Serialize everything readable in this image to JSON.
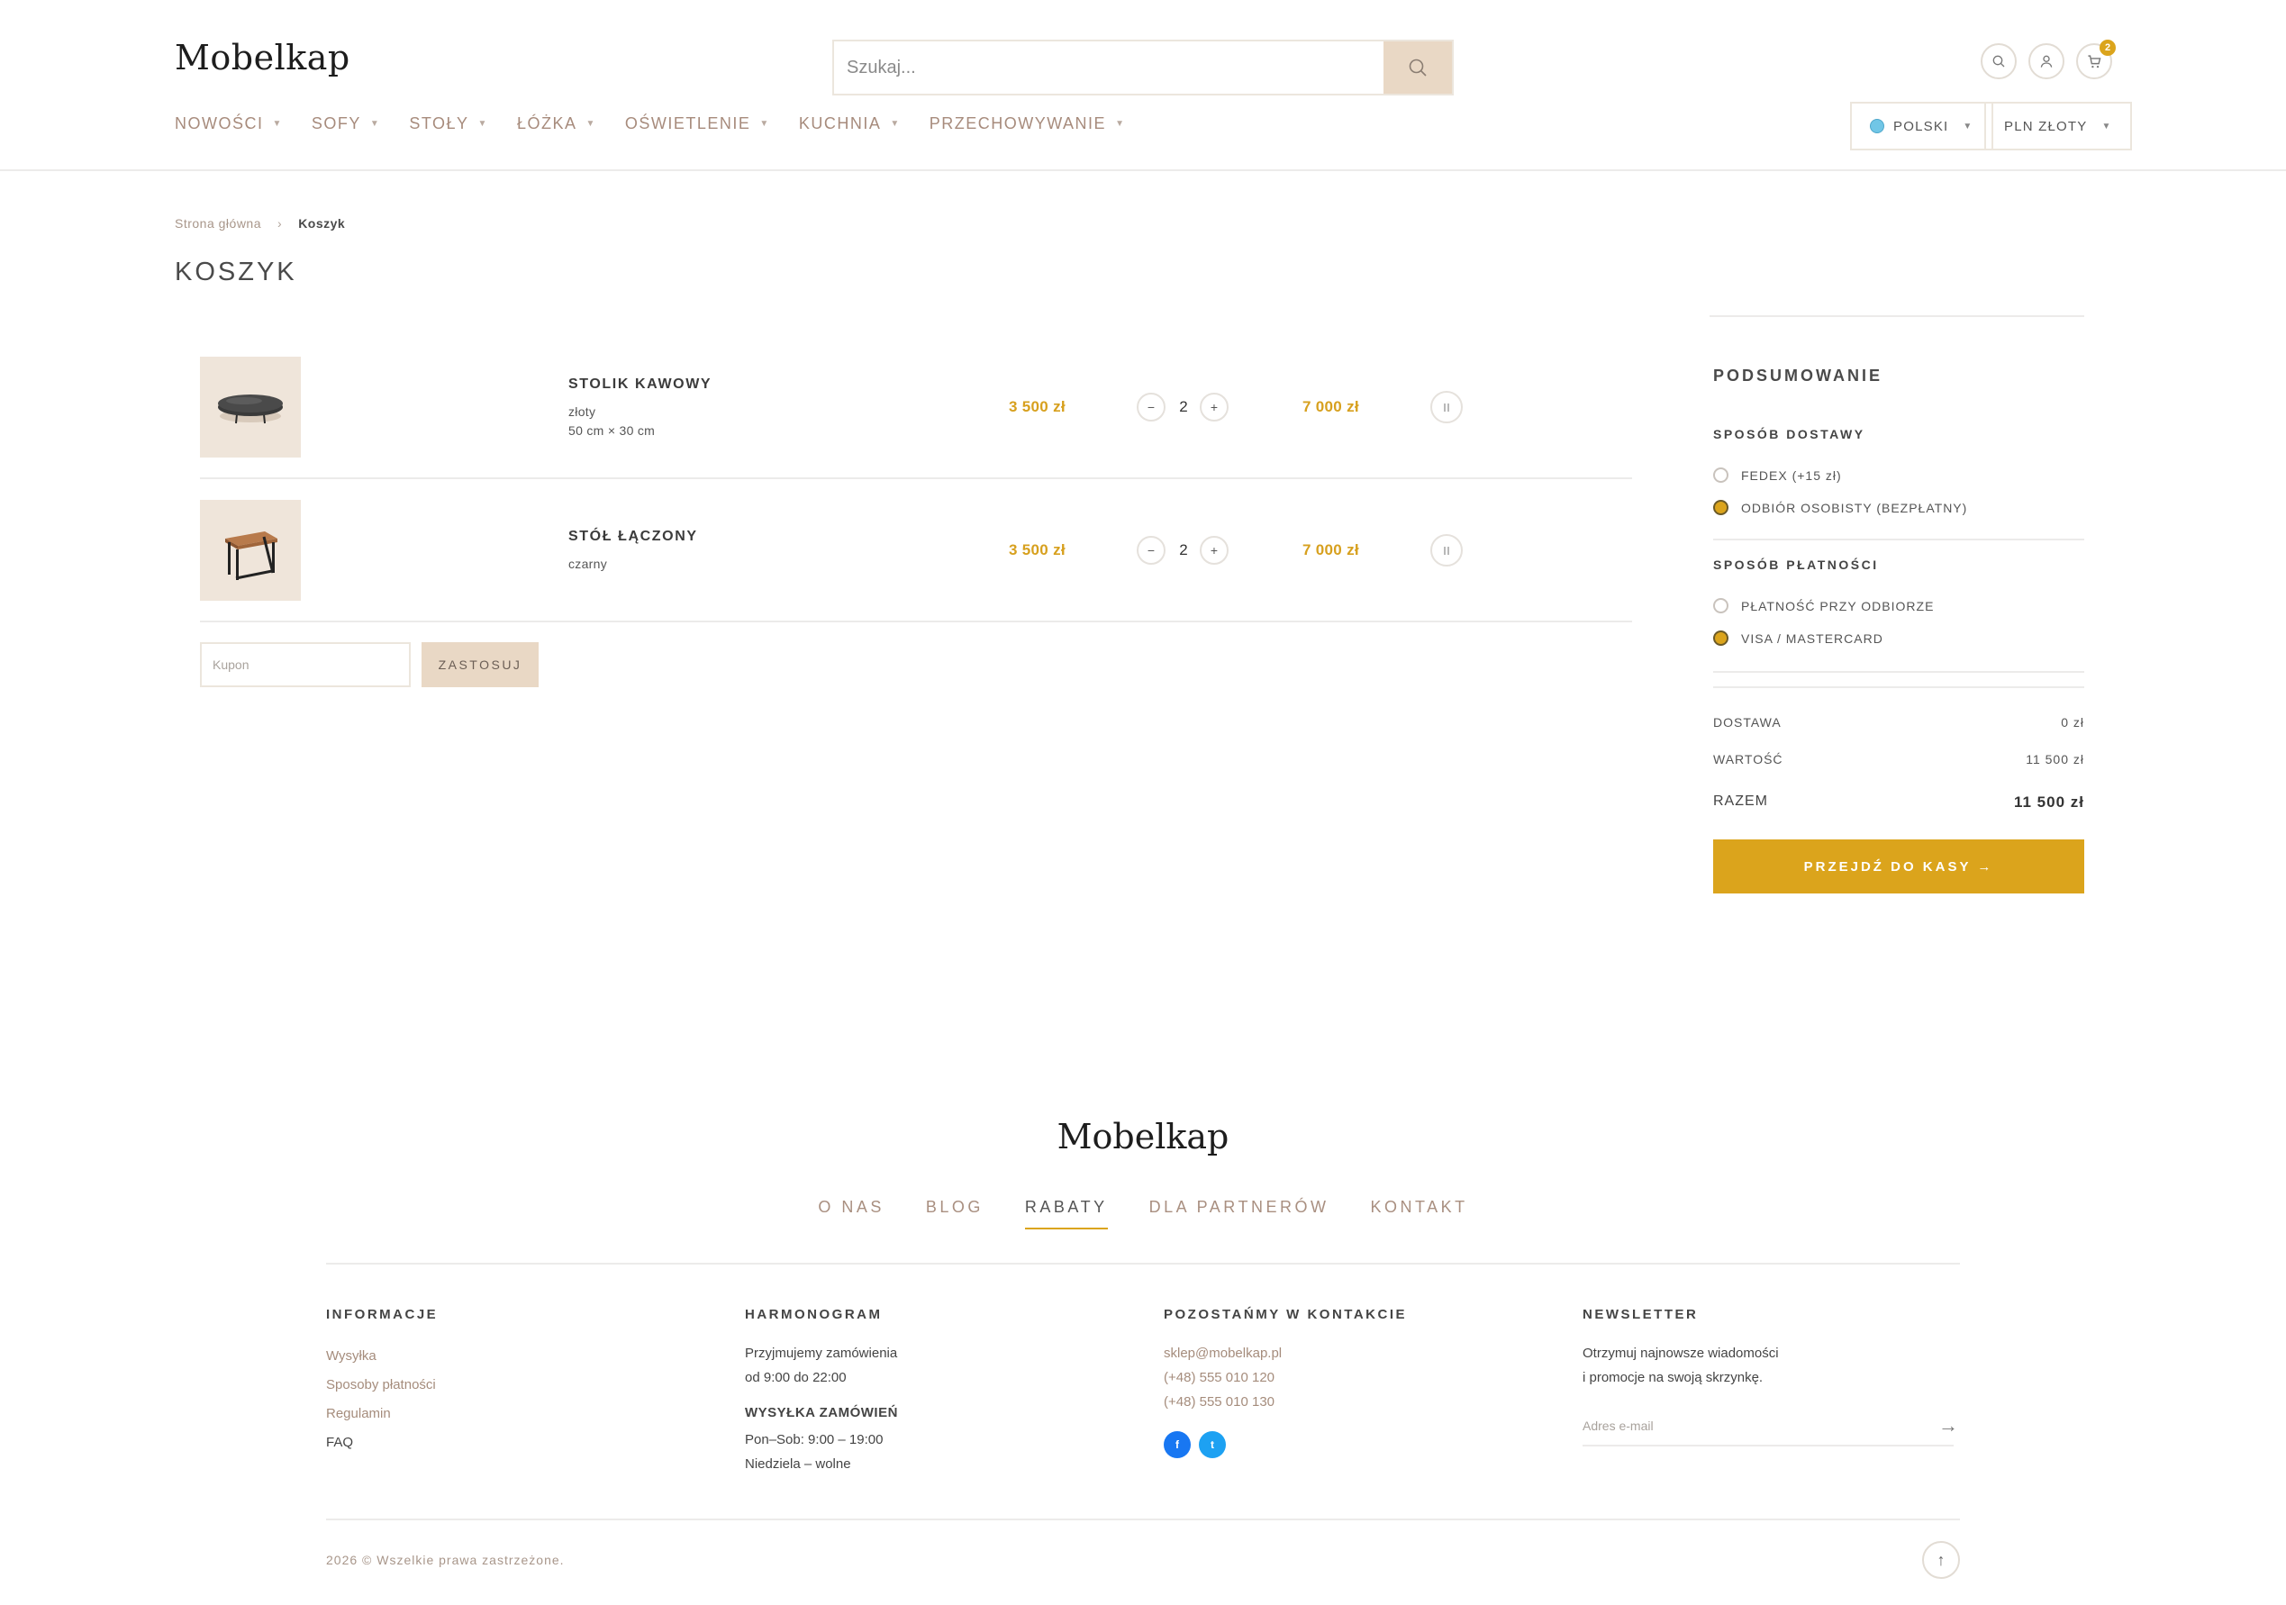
{
  "header": {
    "logo": "Mobelkap",
    "search_placeholder": "Szukaj...",
    "cart_count": "2",
    "language": "POLSKI",
    "currency": "PLN ZŁOTY"
  },
  "nav": [
    {
      "label": "NOWOŚCI"
    },
    {
      "label": "SOFY"
    },
    {
      "label": "STOŁY"
    },
    {
      "label": "ŁÓŻKA"
    },
    {
      "label": "OŚWIETLENIE"
    },
    {
      "label": "KUCHNIA"
    },
    {
      "label": "PRZECHOWYWANIE"
    }
  ],
  "breadcrumb": {
    "home": "Strona główna",
    "sep": "›",
    "current": "Koszyk"
  },
  "page_title": "KOSZYK",
  "cart": {
    "items": [
      {
        "name": "STOLIK KAWOWY",
        "attr1": "złoty",
        "attr2": "50 cm × 30 cm",
        "price": "3 500 zł",
        "qty": "2",
        "total": "7 000 zł"
      },
      {
        "name": "STÓŁ ŁĄCZONY",
        "attr1": "czarny",
        "attr2": "",
        "price": "3 500 zł",
        "qty": "2",
        "total": "7 000 zł"
      }
    ],
    "minus": "−",
    "plus": "+",
    "coupon_placeholder": "Kupon",
    "coupon_button": "ZASTOSUJ"
  },
  "summary": {
    "title": "PODSUMOWANIE",
    "delivery_title": "SPOSÓB DOSTAWY",
    "delivery_options": [
      {
        "label": "FEDEX (+15 zł)",
        "selected": false
      },
      {
        "label": "ODBIÓR OSOBISTY (BEZPŁATNY)",
        "selected": true
      }
    ],
    "payment_title": "SPOSÓB PŁATNOŚCI",
    "payment_options": [
      {
        "label": "PŁATNOŚĆ PRZY ODBIORZE",
        "selected": false
      },
      {
        "label": "VISA / MASTERCARD",
        "selected": true
      }
    ],
    "shipping_label": "DOSTAWA",
    "shipping_value": "0 zł",
    "value_label": "WARTOŚĆ",
    "value_value": "11 500 zł",
    "total_label": "RAZEM",
    "total_value": "11 500 zł",
    "checkout_button": "PRZEJDŹ DO KASY →"
  },
  "footer": {
    "logo": "Mobelkap",
    "nav": [
      {
        "label": "O NAS",
        "active": false
      },
      {
        "label": "BLOG",
        "active": false
      },
      {
        "label": "RABATY",
        "active": true
      },
      {
        "label": "DLA PARTNERÓW",
        "active": false
      },
      {
        "label": "KONTAKT",
        "active": false
      }
    ],
    "info": {
      "title": "INFORMACJE",
      "links": [
        "Wysyłka",
        "Sposoby płatności",
        "Regulamin",
        "FAQ"
      ]
    },
    "schedule": {
      "title": "HARMONOGRAM",
      "line1": "Przyjmujemy zamówienia",
      "line2": "od 9:00 do 22:00",
      "shipping_title": "WYSYŁKA ZAMÓWIEŃ",
      "line3": "Pon–Sob: 9:00 – 19:00",
      "line4": "Niedziela – wolne"
    },
    "contact": {
      "title": "POZOSTAŃMY W KONTAKCIE",
      "email": "sklep@mobelkap.pl",
      "phone1": "(+48) 555 010 120",
      "phone2": "(+48) 555 010 130",
      "facebook": "f",
      "twitter": "t"
    },
    "newsletter": {
      "title": "NEWSLETTER",
      "line1": "Otrzymuj najnowsze wiadomości",
      "line2": "i promocje na swoją skrzynkę.",
      "placeholder": "Adres e-mail",
      "arrow": "→"
    },
    "copyright": "2026 © Wszelkie prawa zastrzeżone.",
    "top_arrow": "↑"
  },
  "colors": {
    "accent": "#dba41c",
    "beige": "#e9d8c5",
    "link": "#a78b7c"
  }
}
